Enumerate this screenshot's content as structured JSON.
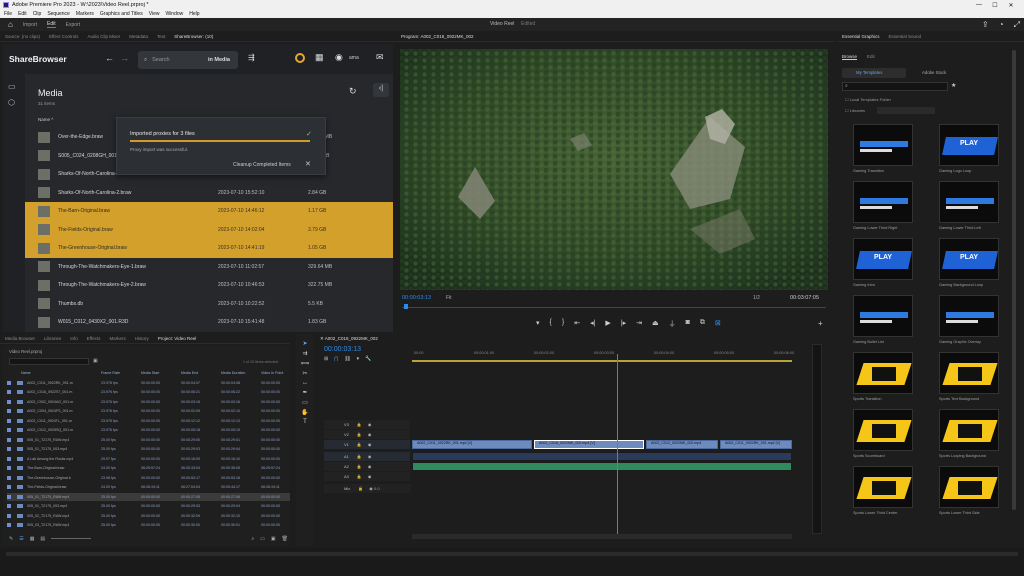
{
  "window": {
    "title": "Adobe Premiere Pro 2023 - W:\\2023\\Video Reel.prproj *",
    "minimize": "—",
    "maximize": "☐",
    "close": "✕"
  },
  "menu": [
    "File",
    "Edit",
    "Clip",
    "Sequence",
    "Markers",
    "Graphics and Titles",
    "View",
    "Window",
    "Help"
  ],
  "workspaces": {
    "items": [
      "Import",
      "Edit",
      "Export"
    ],
    "active": "Edit",
    "center": "Video Reel",
    "center2": "Edited"
  },
  "left_tabs": [
    "Source: (no clips)",
    "Effect Controls",
    "Audio Clip Mixer",
    "Metadata",
    "Text",
    "ShareBrowser: (10)"
  ],
  "sharebrowser": {
    "logo": "ShareBrowser",
    "search_placeholder": "Search",
    "search_scope": "in Media",
    "user": "ama",
    "title": "Media",
    "count": "31 items",
    "col_name": "Name",
    "notification": {
      "title": "Imported proxies for 3 files",
      "detail": "Proxy import was successful.",
      "cleanup": "Cleanup Completed Items"
    },
    "files": [
      {
        "name": "Over-the-Edge.braw",
        "date": "2023-07-10 11:21:52",
        "size": "567.98 MB",
        "selected": false
      },
      {
        "name": "S005_C024_0208GH_001.R3D",
        "date": "2023-07-10 15:21:03",
        "size": "827.9 MB",
        "selected": false
      },
      {
        "name": "Sharks-Of-North-Carolina-1.braw",
        "date": "2023-07-10 15:13:52",
        "size": "3.95 GB",
        "selected": false
      },
      {
        "name": "Sharks-Of-North-Carolina-2.braw",
        "date": "2023-07-10 15:52:10",
        "size": "2.84 GB",
        "selected": false
      },
      {
        "name": "The-Barn-Original.braw",
        "date": "2023-07-10 14:46:12",
        "size": "1.17 GB",
        "selected": true
      },
      {
        "name": "The-Fields-Original.braw",
        "date": "2023-07-10 14:02:04",
        "size": "3.79 GB",
        "selected": true
      },
      {
        "name": "The-Greenhouse-Original.braw",
        "date": "2023-07-10 14:41:19",
        "size": "1.05 GB",
        "selected": true
      },
      {
        "name": "Through-The-Watchmakers-Eye-1.braw",
        "date": "2023-07-10 11:02:57",
        "size": "329.64 MB",
        "selected": false
      },
      {
        "name": "Through-The-Watchmakers-Eye-2.braw",
        "date": "2023-07-10 10:46:53",
        "size": "322.75 MB",
        "selected": false
      },
      {
        "name": "Thumbs.db",
        "date": "2023-07-10 10:22:52",
        "size": "5.5 KB",
        "selected": false
      },
      {
        "name": "W015_C012_0430X2_001.R3D",
        "date": "2023-07-10 15:41:48",
        "size": "1.83 GB",
        "selected": false
      }
    ]
  },
  "program": {
    "tab": "Program: A002_C018_0922MK_002",
    "timecode": "00:00:03:13",
    "fit": "Fit",
    "quality": "1/2",
    "duration": "00:03:07:05"
  },
  "essential_graphics": {
    "tabs": [
      "Essential Graphics",
      "Essential Sound"
    ],
    "subtabs": [
      "Browse",
      "Edit"
    ],
    "my_templates": "My Templates",
    "adobe_stock": "Adobe Stock",
    "local_folder": "Local Templates Folder",
    "libraries": "Libraries",
    "templates": [
      "Gaming Transition",
      "Gaming Logo Loop",
      "Gaming Lower Third Right",
      "Gaming Lower Third Left",
      "Gaming Intro",
      "Gaming Background Loop",
      "Gaming Bullet List",
      "Gaming Graphic Overlay",
      "Sports Transition",
      "Sports Text Background",
      "Sports Scoreboard",
      "Sports Looping Background",
      "Sports Lower Third Center",
      "Sports Lower Third Side"
    ],
    "play_label": "PLAY"
  },
  "project": {
    "tabs": [
      "Media Browser",
      "Libraries",
      "Info",
      "Effects",
      "Markers",
      "History",
      "Project: Video Reel"
    ],
    "file": "Video Reel.prproj",
    "selection": "1 of 23 items selected",
    "cols": [
      "Name",
      "Frame Rate",
      "Media Start",
      "Media End",
      "Media Duration",
      "Video In Point"
    ],
    "rows": [
      [
        "A002_C011_0922RK_001.m",
        "23.976 fps",
        "00:00:00:00",
        "00:00:04:07",
        "00:00:04:08",
        "00:00:00:00"
      ],
      [
        "A002_C016_0922S7_001.m",
        "23.976 fps",
        "00:00:00:00",
        "00:00:06:21",
        "00:00:06:22",
        "00:00:00:00"
      ],
      [
        "A002_C002_0924AG_001.m",
        "23.976 fps",
        "00:00:00:00",
        "00:00:03:15",
        "00:00:03:16",
        "00:00:00:00"
      ],
      [
        "A002_C004_0924FS_001.m",
        "23.976 fps",
        "00:00:00:00",
        "00:00:02:09",
        "00:00:02:10",
        "00:00:00:00"
      ],
      [
        "A002_C011_0924TL_001.m",
        "23.976 fps",
        "00:00:00:00",
        "00:00:12:12",
        "00:00:12:13",
        "00:00:00:00"
      ],
      [
        "A002_C012_0925SQ_001.m",
        "23.976 fps",
        "00:00:00:00",
        "00:00:05:18",
        "00:00:05:19",
        "00:00:00:00"
      ],
      [
        "005_01_T2175_RAW.mp4",
        "25.00 fps",
        "00:00:00:00",
        "00:00:29:00",
        "00:00:29:01",
        "00:00:00:00"
      ],
      [
        "005_01_T2175_003.mp4",
        "25.00 fps",
        "00:00:00:00",
        "00:00:29:03",
        "00:00:29:04",
        "00:00:00:00"
      ],
      [
        "A Lab Among the Rocks.mp4",
        "29.97 fps",
        "00:00:00:00",
        "00:00:16:09",
        "00:00:16:10",
        "00:00:00:00"
      ],
      [
        "The-Barn-Original.braw",
        "24.00 fps",
        "06:29:57:24",
        "06:30:33:04",
        "00:00:35:05",
        "06:29:57:24"
      ],
      [
        "The-Greenhouse-Original.b",
        "23.98 fps",
        "00:00:00:00",
        "00:00:53:17",
        "00:00:53:18",
        "00:00:00:00"
      ],
      [
        "The-Fields-Original.braw",
        "24.00 fps",
        "06:26:19:11",
        "06:27:04:04",
        "00:00:44:17",
        "06:26:19:11"
      ],
      [
        "005_01_T2175_RAW.mp4",
        "25.00 fps",
        "00:00:00:00",
        "00:00:27:05",
        "00:00:27:06",
        "00:00:00:00"
      ],
      [
        "005_01_T2175_003.mp4",
        "25.00 fps",
        "00:00:00:00",
        "00:00:29:03",
        "00:00:29:04",
        "00:00:00:00"
      ],
      [
        "005_02_T2175_RAW.mp4",
        "25.00 fps",
        "00:00:00:00",
        "00:00:32:09",
        "00:00:32:10",
        "00:00:00:00"
      ],
      [
        "005_03_T2175_RAW.mp4",
        "25.00 fps",
        "00:00:00:00",
        "00:00:30:00",
        "00:00:30:01",
        "00:00:00:00"
      ]
    ]
  },
  "timeline": {
    "tab": "A002_C018_0922MK_002",
    "timecode": "00:00:03:13",
    "ruler": [
      "00:00",
      "00:00:01:00",
      "00:00:02:00",
      "00:00:03:00",
      "00:00:04:00",
      "00:00:05:00",
      "00:00:06:00"
    ],
    "tracks": [
      "V3",
      "V2",
      "V1",
      "A1",
      "A2",
      "A3",
      "Mix"
    ],
    "clips": [
      "A002_C011_0922RK_001.mp4 [V]",
      "A002_C018_0922MK_002.mp4 [V]",
      "A002_C012_0922MK_002.mp4",
      "A002_C011_0922RK_001.mp4 [V]"
    ],
    "mix_value": "0.0",
    "playhead_fraction": 0.54
  },
  "colors": {
    "accent": "#2d8ceb",
    "selection": "#d3a12b",
    "video_clip": "#6e8bbd",
    "audio_clip": "#2f8a5d"
  }
}
